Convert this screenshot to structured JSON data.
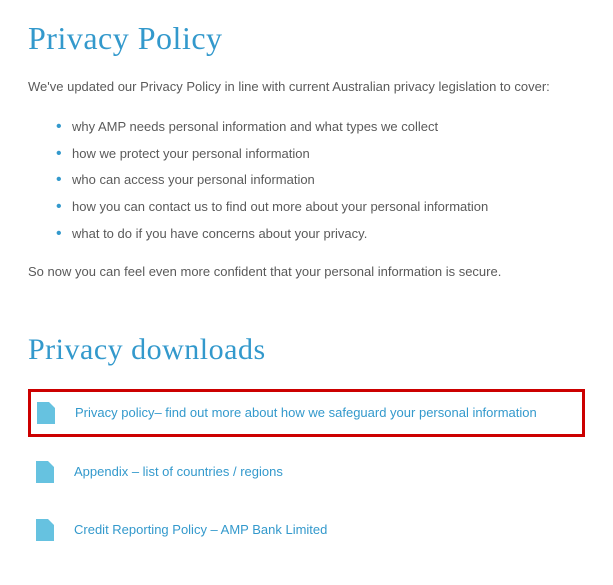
{
  "heading1": "Privacy Policy",
  "intro": "We've updated our Privacy Policy in line with current Australian privacy legislation to cover:",
  "bullets": [
    "why AMP needs personal information and what types we collect",
    "how we protect your personal information",
    "who can access your personal information",
    "how you can contact us to find out more about your personal information",
    "what to do if you have concerns about your privacy."
  ],
  "outro": "So now you can feel even more confident that your personal information is secure.",
  "heading2": "Privacy downloads",
  "downloads": [
    {
      "label": "Privacy policy– find out more about how we safeguard your personal information"
    },
    {
      "label": "Appendix – list of countries / regions"
    },
    {
      "label": "Credit Reporting Policy – AMP Bank Limited"
    }
  ]
}
